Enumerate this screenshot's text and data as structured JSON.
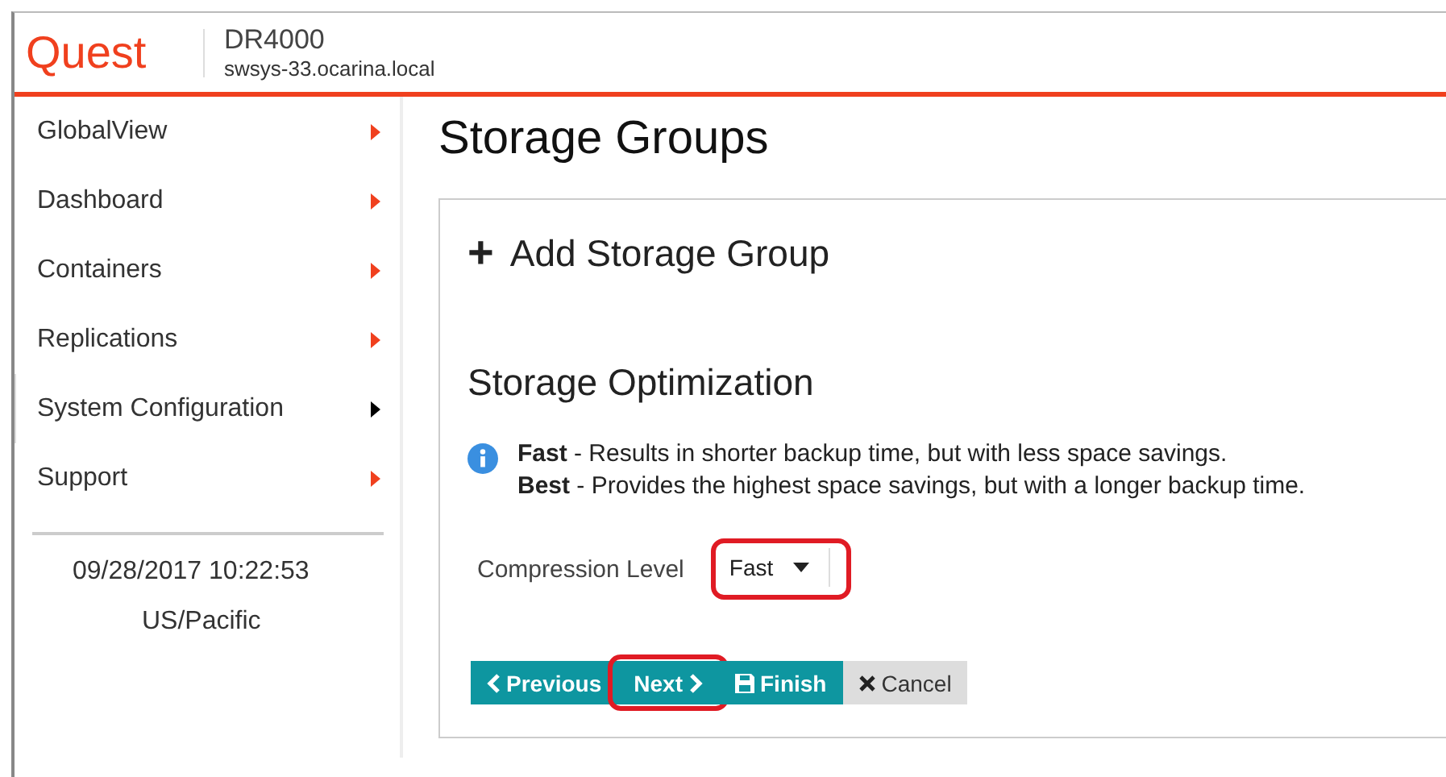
{
  "header": {
    "logo": "Quest",
    "product": "DR4000",
    "host": "swsys-33.ocarina.local"
  },
  "sidebar": {
    "items": [
      {
        "label": "GlobalView",
        "selected": false
      },
      {
        "label": "Dashboard",
        "selected": false
      },
      {
        "label": "Containers",
        "selected": false
      },
      {
        "label": "Replications",
        "selected": false
      },
      {
        "label": "System Configuration",
        "selected": true
      },
      {
        "label": "Support",
        "selected": false
      }
    ],
    "datetime": "09/28/2017 10:22:53",
    "timezone": "US/Pacific"
  },
  "page_title": "Storage Groups",
  "panel": {
    "icon": "+",
    "title": "Add Storage Group",
    "section": "Storage Optimization",
    "info": [
      "**Fast** - Results in shorter backup time, but with less space savings.",
      "**Best** - Provides the highest space savings, but with a longer backup time."
    ],
    "field": {
      "label": "Compression Level",
      "value": "Fast",
      "highlighted": true
    },
    "buttons": [
      {
        "kind": "previous",
        "label": "Previous",
        "highlighted": false
      },
      {
        "kind": "next",
        "label": "Next",
        "highlighted": true
      },
      {
        "kind": "finish",
        "label": "Finish",
        "highlighted": false
      },
      {
        "kind": "cancel",
        "label": "Cancel",
        "highlighted": false
      }
    ]
  }
}
